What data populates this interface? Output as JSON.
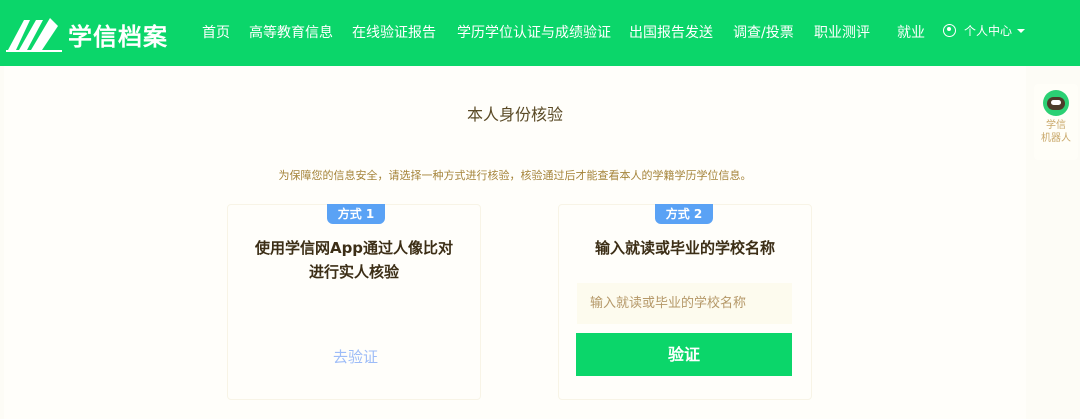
{
  "brand": {
    "name": "学信档案"
  },
  "nav": {
    "items": [
      "首页",
      "高等教育信息",
      "在线验证报告",
      "学历学位认证与成绩验证",
      "出国报告发送",
      "调查/投票",
      "职业测评",
      "就业"
    ],
    "user_center": "个人中心"
  },
  "robot": {
    "line1": "学信",
    "line2": "机器人"
  },
  "page": {
    "title": "本人身份核验",
    "notice": "为保障您的信息安全，请选择一种方式进行核验，核验通过后才能查看本人的学籍学历学位信息。"
  },
  "method1": {
    "tag": "方式 1",
    "title_line1": "使用学信网App通过人像比对",
    "title_line2": "进行实人核验",
    "link": "去验证"
  },
  "method2": {
    "tag": "方式 2",
    "title": "输入就读或毕业的学校名称",
    "input_placeholder": "输入就读或毕业的学校名称",
    "input_value": "",
    "button": "验证"
  },
  "colors": {
    "brand_green": "#0bd66a",
    "tag_blue": "#5aa2f5",
    "link_blue": "#9dbcf8"
  }
}
